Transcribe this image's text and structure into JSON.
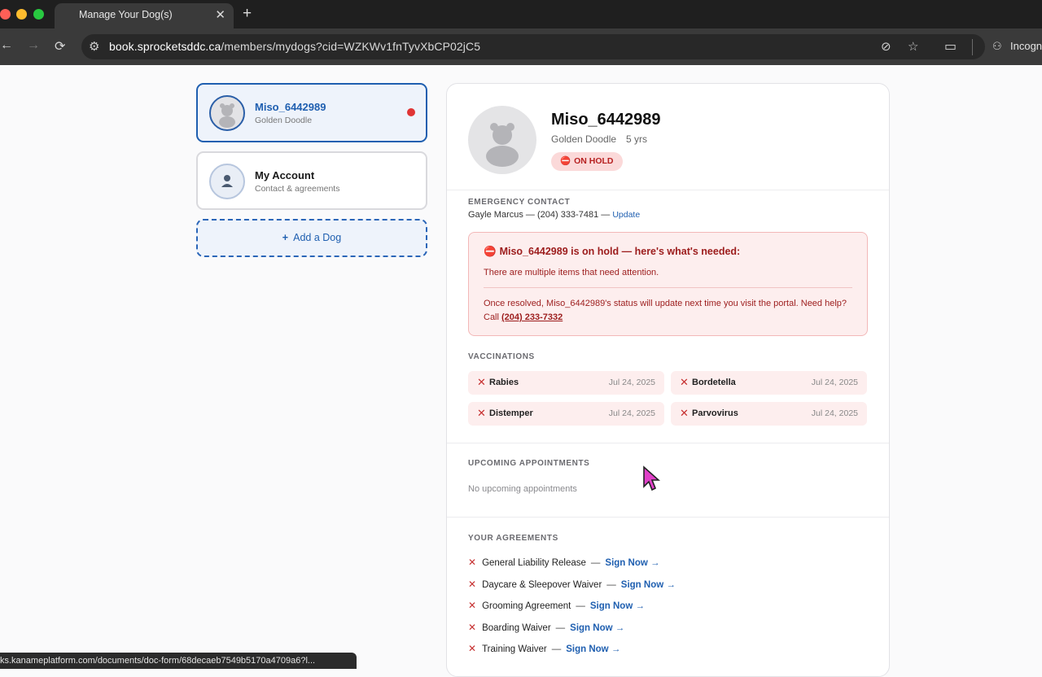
{
  "browser": {
    "tab_title": "Manage Your Dog(s)",
    "url_host": "book.sprocketsddc.ca",
    "url_path": "/members/mydogs?cid=WZKWv1fnTyvXbCP02jC5",
    "profile_label": "Incogn",
    "status_url": "ks.kanameplatform.com/documents/doc-form/68decaeb7549b5170a4709a6?l..."
  },
  "sidebar": {
    "dog": {
      "name": "Miso_6442989",
      "breed": "Golden Doodle"
    },
    "account": {
      "title": "My Account",
      "subtitle": "Contact & agreements"
    },
    "add_dog_label": "Add a Dog"
  },
  "profile": {
    "name": "Miso_6442989",
    "breed": "Golden Doodle",
    "age": "5 yrs",
    "status_badge": "ON HOLD"
  },
  "emergency": {
    "title": "EMERGENCY CONTACT",
    "contact": "Gayle Marcus — (204) 333-7481 —",
    "update_label": "Update"
  },
  "alert": {
    "title": "Miso_6442989 is on hold — here's what's needed:",
    "body": "There are multiple items that need attention.",
    "footer": "Once resolved, Miso_6442989's status will update next time you visit the portal. Need help? Call",
    "phone": "(204) 233-7332"
  },
  "vaccinations": {
    "title": "VACCINATIONS",
    "items": [
      {
        "name": "Rabies",
        "date": "Jul 24, 2025"
      },
      {
        "name": "Bordetella",
        "date": "Jul 24, 2025"
      },
      {
        "name": "Distemper",
        "date": "Jul 24, 2025"
      },
      {
        "name": "Parvovirus",
        "date": "Jul 24, 2025"
      }
    ]
  },
  "appointments": {
    "title": "UPCOMING APPOINTMENTS",
    "empty_text": "No upcoming appointments"
  },
  "agreements": {
    "title": "YOUR AGREEMENTS",
    "sign_label": "Sign Now →",
    "items": [
      {
        "name": "General Liability Release"
      },
      {
        "name": "Daycare & Sleepover Waiver"
      },
      {
        "name": "Grooming Agreement"
      },
      {
        "name": "Boarding Waiver"
      },
      {
        "name": "Training Waiver"
      }
    ]
  },
  "colors": {
    "accent": "#1f5fb0",
    "danger": "#b62020",
    "danger_bg": "#fdeeee"
  }
}
